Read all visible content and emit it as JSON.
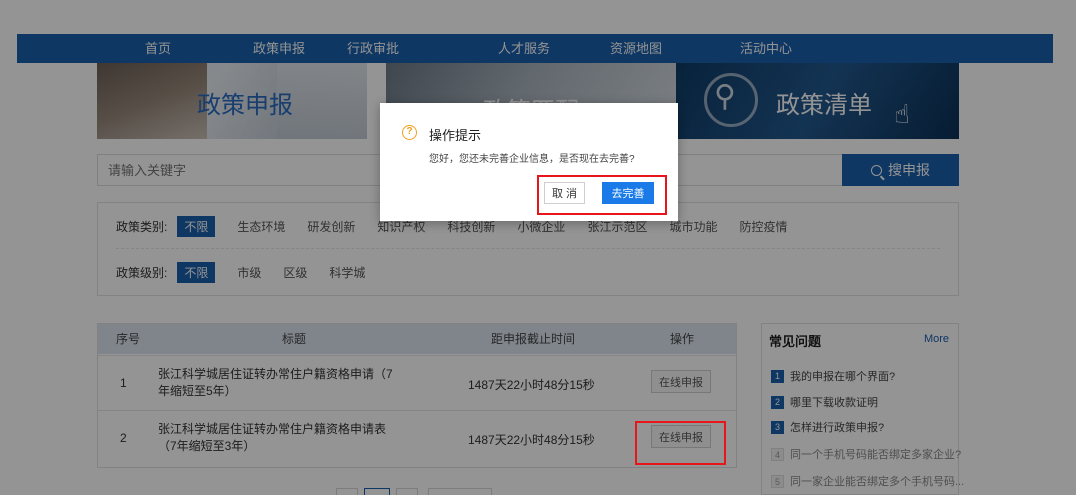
{
  "nav": {
    "items": [
      "首页",
      "政策申报",
      "行政审批",
      "人才服务",
      "资源地图",
      "活动中心"
    ]
  },
  "banners": {
    "policy_apply": "政策申报",
    "policy_match": "政策匹配",
    "policy_list": "政策清单"
  },
  "search": {
    "placeholder": "请输入关键字",
    "button_label": "搜申报"
  },
  "filters": {
    "category_label": "政策类别:",
    "category_options": [
      "不限",
      "生态环境",
      "研发创新",
      "知识产权",
      "科技创新",
      "小微企业",
      "张江示范区",
      "城市功能",
      "防控疫情"
    ],
    "level_label": "政策级别:",
    "level_options": [
      "不限",
      "市级",
      "区级",
      "科学城"
    ]
  },
  "table": {
    "headers": [
      "序号",
      "标题",
      "距申报截止时间",
      "操作"
    ],
    "rows": [
      {
        "no": "1",
        "title": "张江科学城居住证转办常住户籍资格申请（7年缩短至5年）",
        "time": "1487天22小时48分15秒",
        "action": "在线申报"
      },
      {
        "no": "2",
        "title": "张江科学城居住证转办常住户籍资格申请表 （7年缩短至3年）",
        "time": "1487天22小时48分15秒",
        "action": "在线申报"
      }
    ]
  },
  "faq": {
    "title": "常见问题",
    "more": "More",
    "items": [
      {
        "num": "1",
        "text": "我的申报在哪个界面?"
      },
      {
        "num": "2",
        "text": "哪里下载收款证明"
      },
      {
        "num": "3",
        "text": "怎样进行政策申报?"
      },
      {
        "num": "4",
        "text": "同一个手机号码能否绑定多家企业?"
      },
      {
        "num": "5",
        "text": "同一家企业能否绑定多个手机号码..."
      }
    ]
  },
  "modal": {
    "title": "操作提示",
    "message": "您好，您还未完善企业信息，是否现在去完善?",
    "cancel": "取 消",
    "confirm": "去完善"
  },
  "colors": {
    "brand_blue": "#1a5fab",
    "modal_confirm_blue": "#1a7be8",
    "highlight_red": "#e8151b",
    "warning_orange": "#f0a020"
  }
}
